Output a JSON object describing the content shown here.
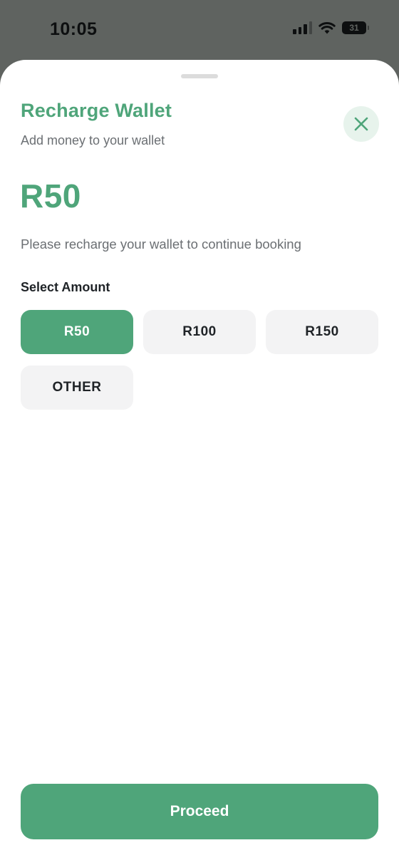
{
  "status_bar": {
    "time": "10:05",
    "battery_level": "31",
    "icons": [
      "cellular-signal-icon",
      "wifi-icon",
      "battery-icon"
    ]
  },
  "sheet": {
    "title": "Recharge Wallet",
    "subtitle": "Add money to your wallet",
    "close_icon": "close-icon",
    "amount_display": "R50",
    "note": "Please recharge your wallet to continue booking",
    "select_amount_label": "Select Amount",
    "options": [
      {
        "label": "R50",
        "selected": true
      },
      {
        "label": "R100",
        "selected": false
      },
      {
        "label": "R150",
        "selected": false
      },
      {
        "label": "OTHER",
        "selected": false
      }
    ],
    "proceed_label": "Proceed"
  },
  "colors": {
    "accent": "#4fa57a",
    "chip_bg": "#f3f3f4",
    "close_bg": "#e7f3ec",
    "status_bar_bg": "#5f6360"
  }
}
